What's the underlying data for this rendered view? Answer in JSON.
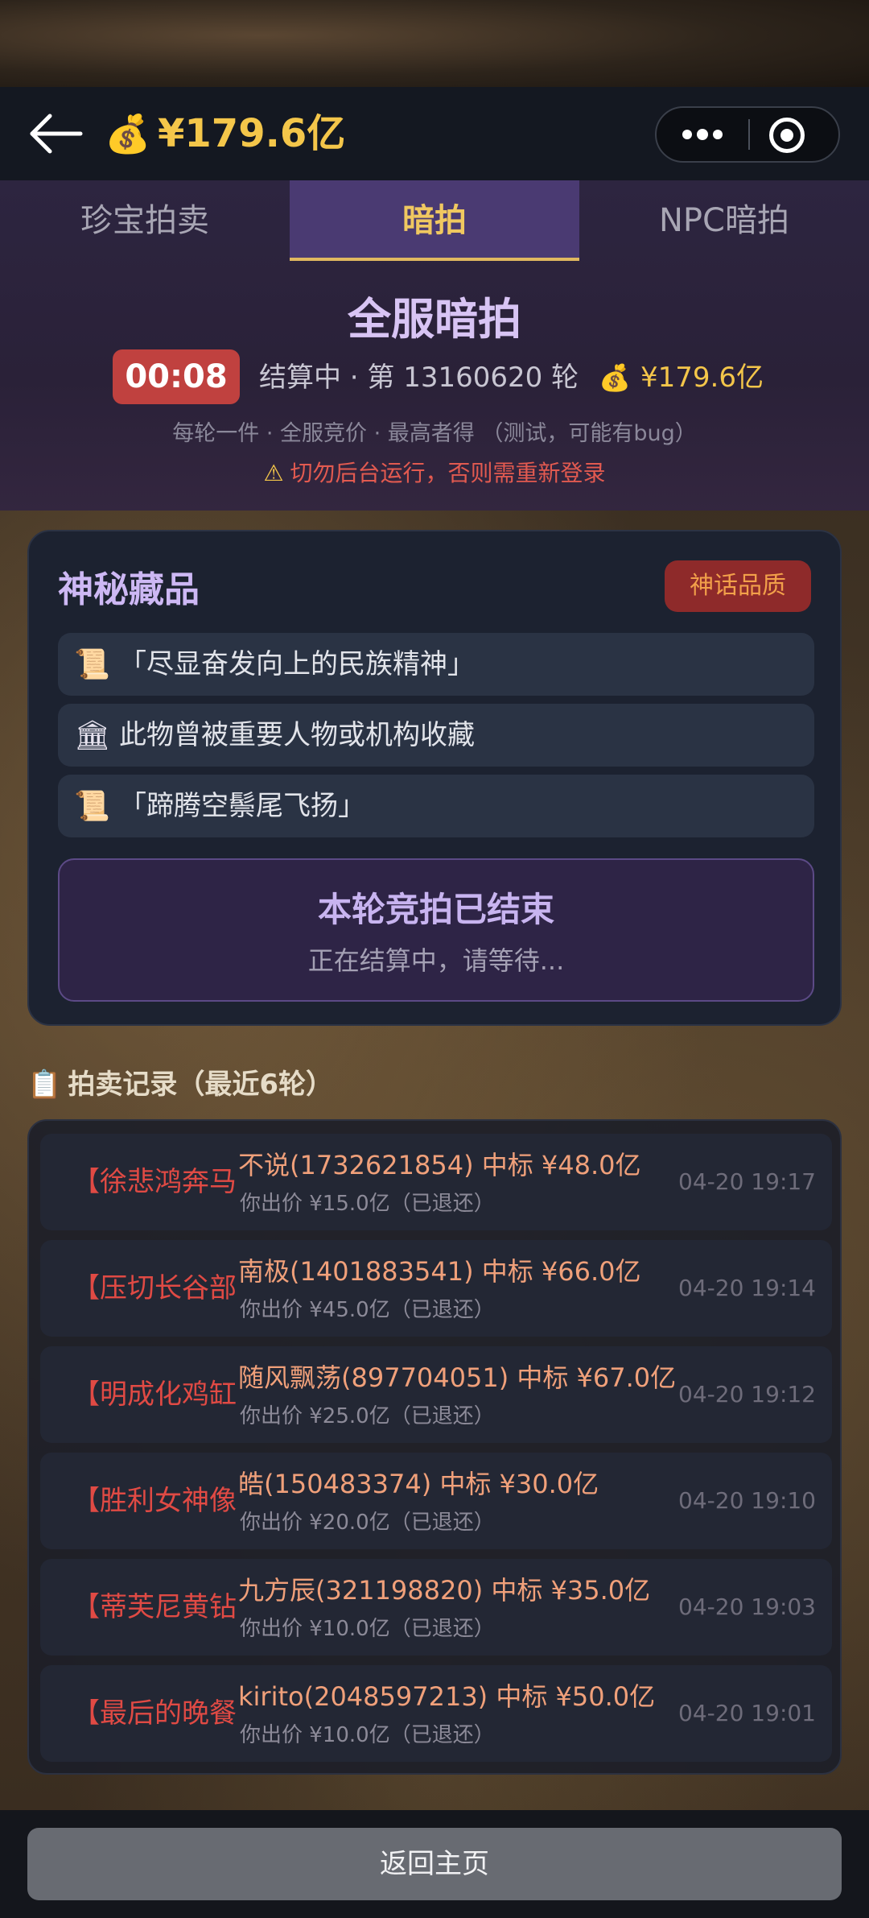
{
  "header": {
    "balance": "¥179.6亿",
    "icons": {
      "back": "back-arrow-icon",
      "money": "money-bag-icon",
      "more": "more-dots-icon",
      "close": "target-circle-icon"
    }
  },
  "tabs": [
    {
      "label": "珍宝拍卖",
      "active": false
    },
    {
      "label": "暗拍",
      "active": true
    },
    {
      "label": "NPC暗拍",
      "active": false
    }
  ],
  "banner": {
    "title": "全服暗拍",
    "timer": "00:08",
    "round_text": "结算中 · 第 13160620 轮",
    "balance": "¥179.6亿",
    "rules": "每轮一件 · 全服竞价 · 最高者得 （测试，可能有bug）",
    "warning": "切勿后台运行，否则需重新登录"
  },
  "item": {
    "title": "神秘藏品",
    "quality": "神话品质",
    "clues": [
      {
        "icon": "scroll-icon",
        "glyph": "📜",
        "text": "「尽显奋发向上的民族精神」"
      },
      {
        "icon": "museum-icon",
        "glyph": "🏛",
        "text": "此物曾被重要人物或机构收藏"
      },
      {
        "icon": "scroll-icon",
        "glyph": "📜",
        "text": "「蹄腾空鬃尾飞扬」"
      }
    ],
    "ended_title": "本轮竞拍已结束",
    "ended_sub": "正在结算中，请等待..."
  },
  "records": {
    "header": "拍卖记录（最近6轮）",
    "rows": [
      {
        "item": "【徐悲鸿奔马",
        "winner": "不说(1732621854) 中标 ¥48.0亿",
        "bid": "你出价 ¥15.0亿（已退还）",
        "time": "04-20 19:17"
      },
      {
        "item": "【压切长谷部",
        "winner": "南极(1401883541) 中标 ¥66.0亿",
        "bid": "你出价 ¥45.0亿（已退还）",
        "time": "04-20 19:14"
      },
      {
        "item": "【明成化鸡缸",
        "winner": "随风飘荡(897704051) 中标 ¥67.0亿",
        "bid": "你出价 ¥25.0亿（已退还）",
        "time": "04-20 19:12"
      },
      {
        "item": "【胜利女神像",
        "winner": "皓(150483374) 中标 ¥30.0亿",
        "bid": "你出价 ¥20.0亿（已退还）",
        "time": "04-20 19:10"
      },
      {
        "item": "【蒂芙尼黄钻",
        "winner": "九方辰(321198820) 中标 ¥35.0亿",
        "bid": "你出价 ¥10.0亿（已退还）",
        "time": "04-20 19:03"
      },
      {
        "item": "【最后的晚餐",
        "winner": "kirito(2048597213) 中标 ¥50.0亿",
        "bid": "你出价 ¥10.0亿（已退还）",
        "time": "04-20 19:01"
      }
    ]
  },
  "footer": {
    "home_label": "返回主页"
  }
}
